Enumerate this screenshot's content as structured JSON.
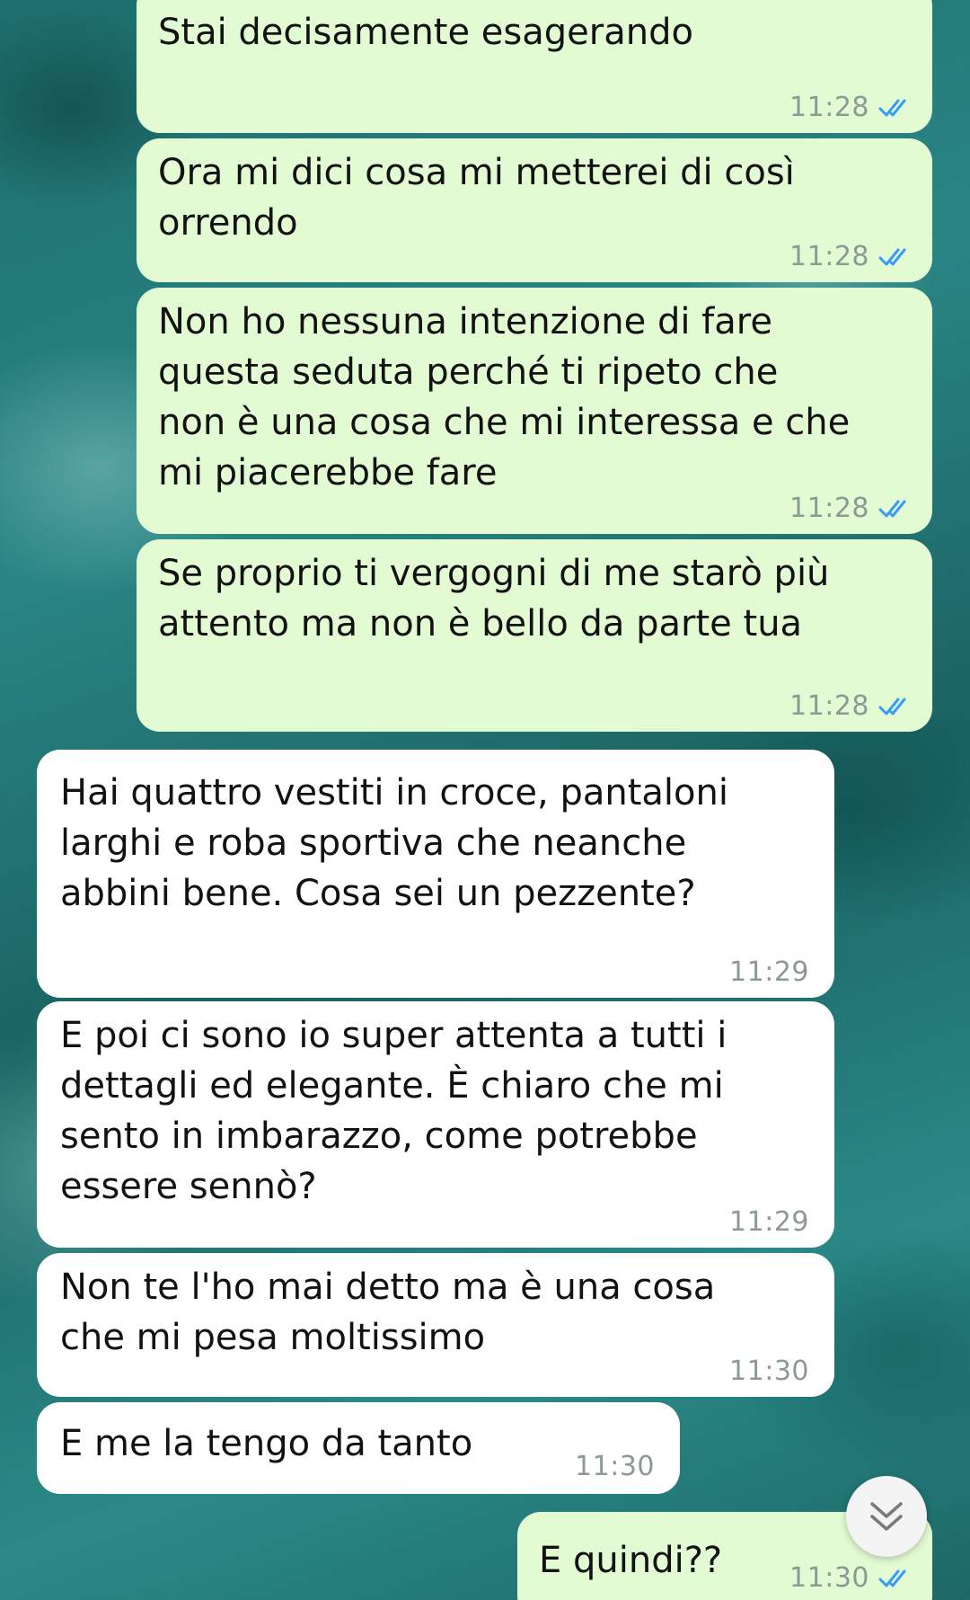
{
  "colors": {
    "outgoing_bubble": "#e3fbd3",
    "incoming_bubble": "#ffffff",
    "read_ticks": "#3a9bf5",
    "timestamp": "#8c9a93"
  },
  "messages": [
    {
      "direction": "outgoing",
      "text": "Stai decisamente esagerando",
      "time": "11:28",
      "status": "read"
    },
    {
      "direction": "outgoing",
      "text": "Ora mi dici cosa mi metterei di così\norrendo",
      "time": "11:28",
      "status": "read"
    },
    {
      "direction": "outgoing",
      "text": "Non ho nessuna intenzione di fare\nquesta seduta perché ti ripeto che\nnon è una cosa che mi interessa e che\nmi piacerebbe fare",
      "time": "11:28",
      "status": "read"
    },
    {
      "direction": "outgoing",
      "text": "Se proprio ti vergogni di me starò più\nattento ma non è bello da parte tua",
      "time": "11:28",
      "status": "read"
    },
    {
      "direction": "incoming",
      "text": "Hai quattro vestiti in croce, pantaloni\nlarghi e roba sportiva che neanche\nabbini bene. Cosa sei un pezzente?",
      "time": "11:29"
    },
    {
      "direction": "incoming",
      "text": "E poi ci sono io super attenta a tutti i\ndettagli ed elegante. È chiaro che mi\nsento in imbarazzo, come potrebbe\nessere sennò?",
      "time": "11:29"
    },
    {
      "direction": "incoming",
      "text": "Non te l'ho mai detto ma è una cosa\nche mi pesa moltissimo",
      "time": "11:30"
    },
    {
      "direction": "incoming",
      "text": "E me la tengo da tanto",
      "time": "11:30"
    },
    {
      "direction": "outgoing",
      "text": "E quindi??",
      "time": "11:30",
      "status": "read"
    }
  ],
  "scroll_button": {
    "icon": "double-chevron-down-icon"
  }
}
